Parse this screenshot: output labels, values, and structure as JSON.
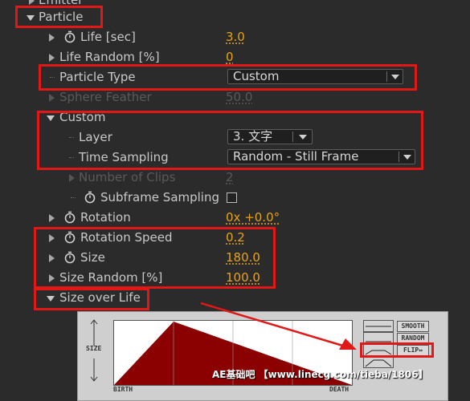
{
  "rows": {
    "emitter": "Emitter",
    "particle": "Particle",
    "life": {
      "label": "Life [sec]",
      "value": "3.0"
    },
    "life_random": {
      "label": "Life Random [%]",
      "value": "0"
    },
    "particle_type": {
      "label": "Particle Type",
      "value": "Custom"
    },
    "sphere_feather": {
      "label": "Sphere Feather",
      "value": "50.0"
    },
    "custom": "Custom",
    "layer": {
      "label": "Layer",
      "value": "3. 文字"
    },
    "time_sampling": {
      "label": "Time Sampling",
      "value": "Random - Still Frame"
    },
    "number_of_clips": {
      "label": "Number of Clips",
      "value": "2"
    },
    "subframe_sampling": {
      "label": "Subframe Sampling"
    },
    "rotation": {
      "label": "Rotation",
      "value": "0x +0.0°"
    },
    "rotation_speed": {
      "label": "Rotation Speed",
      "value": "0.2"
    },
    "size": {
      "label": "Size",
      "value": "180.0"
    },
    "size_random": {
      "label": "Size Random [%]",
      "value": "100.0"
    },
    "size_over_life": "Size over Life"
  },
  "graph": {
    "y_label": "SIZE",
    "x_start": "BIRTH",
    "x_end": "DEATH",
    "buttons": {
      "smooth": "SMOOTH",
      "random": "RANDOM",
      "flip": "FLIP↔"
    }
  },
  "watermark": "AE基础吧 【www.linecg.com/tieba/1806】",
  "colors": {
    "value": "#e6a21a",
    "highlight": "#e01818",
    "curve": "#8b0000"
  }
}
